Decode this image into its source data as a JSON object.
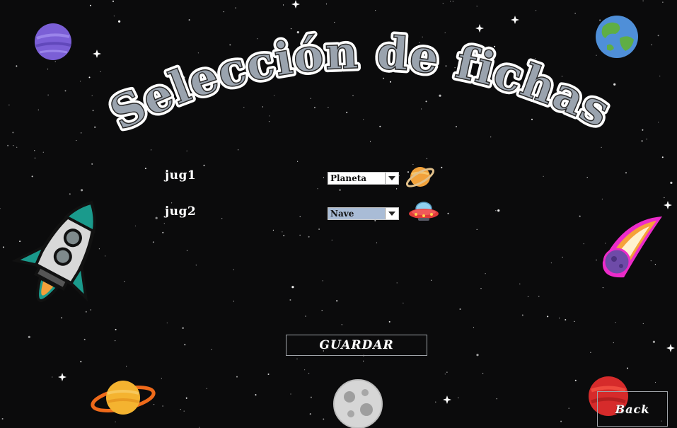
{
  "title": "Selección de fichas",
  "players": [
    {
      "label": "jug1",
      "piece": "Planeta",
      "piece_icon": "saturn-icon"
    },
    {
      "label": "jug2",
      "piece": "Nave",
      "piece_icon": "ufo-icon"
    }
  ],
  "buttons": {
    "save": "GUARDAR",
    "back": "Back"
  },
  "colors": {
    "background": "#0b0b0c",
    "title_fill": "#9aa3ae",
    "selected_highlight": "#a9bcd6"
  },
  "decorations": [
    "purple-planet-icon",
    "earth-icon",
    "rocket-icon",
    "comet-icon",
    "ringed-planet-icon",
    "moon-icon",
    "mars-icon"
  ]
}
